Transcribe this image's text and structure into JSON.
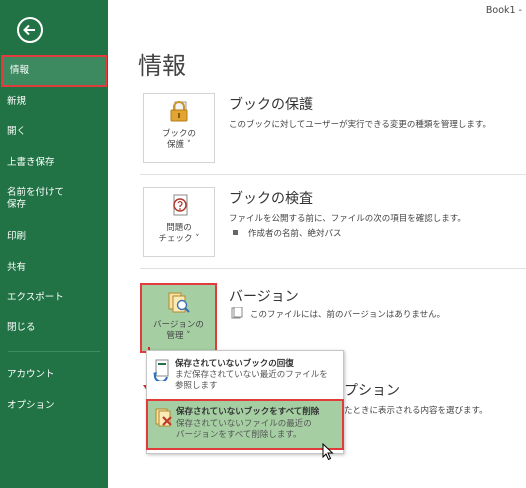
{
  "window": {
    "title": "Book1 -"
  },
  "sidebar": {
    "back_icon": "back-arrow-icon",
    "items": [
      {
        "label": "情報",
        "active": true
      },
      {
        "label": "新規"
      },
      {
        "label": "開く"
      },
      {
        "label": "上書き保存"
      },
      {
        "label": "名前を付けて\n保存"
      },
      {
        "label": "印刷"
      },
      {
        "label": "共有"
      },
      {
        "label": "エクスポート"
      },
      {
        "label": "閉じる"
      },
      {
        "label": "アカウント"
      },
      {
        "label": "オプション"
      }
    ]
  },
  "main": {
    "title": "情報",
    "sections": {
      "protect": {
        "tile_label": "ブックの\n保護 ˅",
        "heading": "ブックの保護",
        "description": "このブックに対してユーザーが実行できる変更の種類を管理します。"
      },
      "inspect": {
        "tile_label": "問題の\nチェック ˅",
        "heading": "ブックの検査",
        "description": "ファイルを公開する前に、ファイルの次の項目を確認します。",
        "bullet": "作成者の名前、絶対パス"
      },
      "versions": {
        "tile_label": "バージョンの\n管理 ˅",
        "heading": "バージョン",
        "description": "このファイルには、前のバージョンはありません。"
      },
      "partial": {
        "heading_tail": "プション",
        "description_tail": "たときに表示される内容を選びます。"
      }
    },
    "menu": {
      "items": [
        {
          "title": "保存されていないブックの回復",
          "description": "まだ保存されていない最近のファイルを\n参照します"
        },
        {
          "title": "保存されていないブックをすべて削除",
          "description": "保存されていないファイルの最近の\nバージョンをすべて削除します。"
        }
      ]
    }
  },
  "colors": {
    "sidebar": "#217346",
    "highlight": "#a5cfa3",
    "annotation": "#e23b3b"
  }
}
